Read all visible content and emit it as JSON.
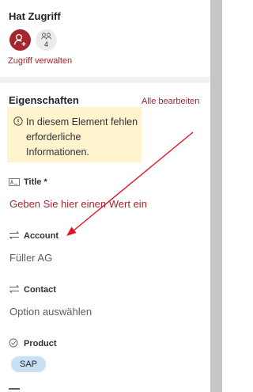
{
  "access": {
    "title": "Hat Zugriff",
    "member_count": "4",
    "manage_link": "Zugriff verwalten"
  },
  "properties": {
    "title": "Eigenschaften",
    "edit_all": "Alle bearbeiten",
    "notice": "In diesem Element fehlen erforderliche Informationen."
  },
  "fields": [
    {
      "label": "Title *",
      "value": "Geben Sie hier einen Wert ein",
      "icon": "text-field-icon"
    },
    {
      "label": "Account",
      "value": "Füller AG",
      "icon": "lookup-arrows-icon"
    },
    {
      "label": "Contact",
      "value": "Option auswählen",
      "icon": "lookup-arrows-icon"
    },
    {
      "label": "Product",
      "value": "SAP",
      "icon": "choice-check-icon"
    }
  ],
  "colors": {
    "accent": "#a4262c",
    "notice_background": "#fff4ce",
    "tag_background": "#c7e0f4",
    "annotation_arrow": "#e81123"
  }
}
